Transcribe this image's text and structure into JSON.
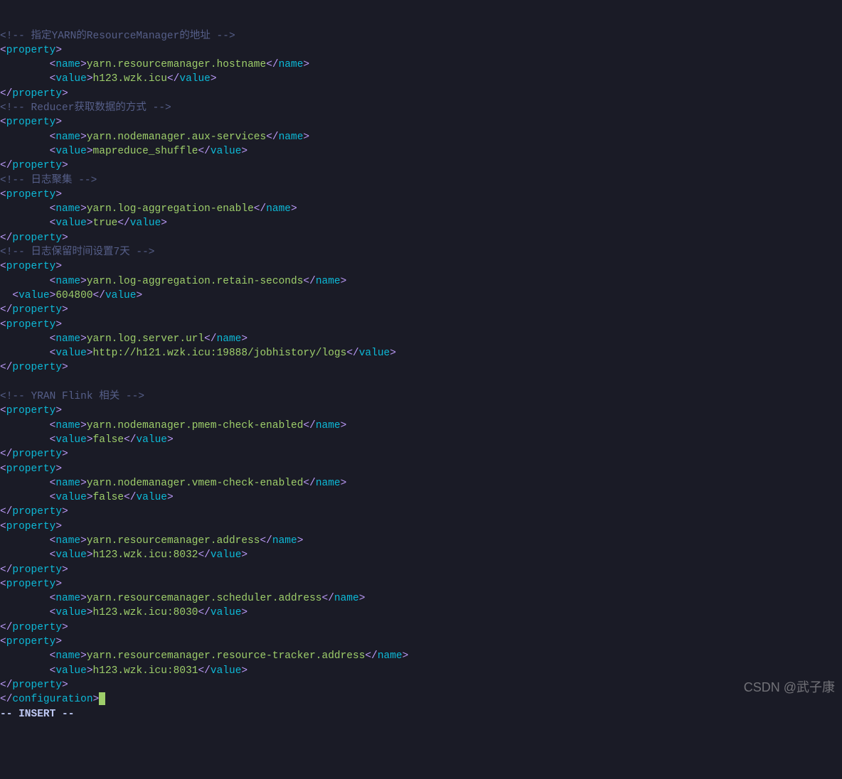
{
  "comments": {
    "c1": "<!-- 指定YARN的ResourceManager的地址 -->",
    "c2": "<!-- Reducer获取数据的方式 -->",
    "c3": "<!-- 日志聚集 -->",
    "c4": "<!-- 日志保留时间设置7天 -->",
    "c5": "<!-- YRAN Flink 相关 -->"
  },
  "properties": [
    {
      "name": "yarn.resourcemanager.hostname",
      "value": "h123.wzk.icu"
    },
    {
      "name": "yarn.nodemanager.aux-services",
      "value": "mapreduce_shuffle"
    },
    {
      "name": "yarn.log-aggregation-enable",
      "value": "true"
    },
    {
      "name": "yarn.log-aggregation.retain-seconds",
      "value": "604800"
    },
    {
      "name": "yarn.log.server.url",
      "value": "http://h121.wzk.icu:19888/jobhistory/logs"
    },
    {
      "name": "yarn.nodemanager.pmem-check-enabled",
      "value": "false"
    },
    {
      "name": "yarn.nodemanager.vmem-check-enabled",
      "value": "false"
    },
    {
      "name": "yarn.resourcemanager.address",
      "value": "h123.wzk.icu:8032"
    },
    {
      "name": "yarn.resourcemanager.scheduler.address",
      "value": "h123.wzk.icu:8030"
    },
    {
      "name": "yarn.resourcemanager.resource-tracker.address",
      "value": "h123.wzk.icu:8031"
    }
  ],
  "tags": {
    "property_open": "<property>",
    "property_close": "</property>",
    "name_open": "<name>",
    "name_close": "</name>",
    "value_open": "<value>",
    "value_close": "</value>",
    "configuration_close": "</configuration>"
  },
  "mode": "-- INSERT --",
  "watermark": "CSDN @武子康"
}
